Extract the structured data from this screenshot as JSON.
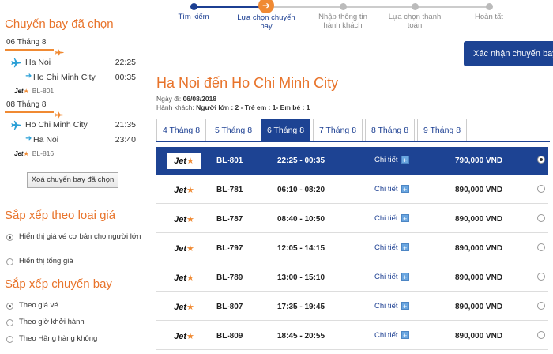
{
  "sidebar": {
    "selected_title": "Chuyến bay đã chọn",
    "segments": [
      {
        "date": "06 Tháng 8",
        "from": "Ha Noi",
        "dep_time": "22:25",
        "to": "Ho Chi Minh City",
        "arr_time": "00:35",
        "airline_logo": "Jet",
        "flight": "BL-801"
      },
      {
        "date": "08 Tháng 8",
        "from": "Ho Chi Minh City",
        "dep_time": "21:35",
        "to": "Ha Noi",
        "arr_time": "23:40",
        "airline_logo": "Jet",
        "flight": "BL-816"
      }
    ],
    "clear_button": "Xoá chuyến bay đã chọn",
    "price_sort_title": "Sắp xếp theo loại giá",
    "price_options": [
      "Hiển thị giá vé cơ bản cho người lớn",
      "Hiển thị tổng giá"
    ],
    "price_selected": 0,
    "flight_sort_title": "Sắp xếp chuyến bay",
    "flight_options": [
      "Theo giá vé",
      "Theo giờ khởi hành",
      "Theo Hãng hàng không"
    ],
    "flight_selected": 0
  },
  "stepper": {
    "steps": [
      "Tìm kiếm",
      "Lựa chọn chuyến bay",
      "Nhập thông tin hành khách",
      "Lựa chọn thanh toán",
      "Hoàn tất"
    ],
    "step_lines": [
      [
        "Tìm kiếm"
      ],
      [
        "Lựa chọn chuyến",
        "bay"
      ],
      [
        "Nhập thông tin",
        "hành khách"
      ],
      [
        "Lựa chọn thanh",
        "toán"
      ],
      [
        "Hoàn tất"
      ]
    ],
    "active_index": 1,
    "active_icon": "➔"
  },
  "confirm_button": "Xác nhận chuyến bay",
  "route": {
    "from": "Ha Noi",
    "connector": "đến",
    "to": "Ho Chi Minh City"
  },
  "departure_label": "Ngày đi:",
  "departure_date": "06/08/2018",
  "passenger_label": "Hành khách:",
  "passengers": "Người lớn : 2 - Trẻ em : 1- Em bé : 1",
  "date_tabs": [
    "4 Tháng 8",
    "5 Tháng 8",
    "6 Tháng 8",
    "7 Tháng 8",
    "8 Tháng 8",
    "9 Tháng 8"
  ],
  "active_tab": 2,
  "flights": [
    {
      "logo": "Jet",
      "code": "BL-801",
      "times": "22:25 - 00:35",
      "detail": "Chi tiết",
      "price": "790,000 VND",
      "selected": true
    },
    {
      "logo": "Jet",
      "code": "BL-781",
      "times": "06:10 - 08:20",
      "detail": "Chi tiết",
      "price": "890,000 VND",
      "selected": false
    },
    {
      "logo": "Jet",
      "code": "BL-787",
      "times": "08:40 - 10:50",
      "detail": "Chi tiết",
      "price": "890,000 VND",
      "selected": false
    },
    {
      "logo": "Jet",
      "code": "BL-797",
      "times": "12:05 - 14:15",
      "detail": "Chi tiết",
      "price": "890,000 VND",
      "selected": false
    },
    {
      "logo": "Jet",
      "code": "BL-789",
      "times": "13:00 - 15:10",
      "detail": "Chi tiết",
      "price": "890,000 VND",
      "selected": false
    },
    {
      "logo": "Jet",
      "code": "BL-807",
      "times": "17:35 - 19:45",
      "detail": "Chi tiết",
      "price": "890,000 VND",
      "selected": false
    },
    {
      "logo": "Jet",
      "code": "BL-809",
      "times": "18:45 - 20:55",
      "detail": "Chi tiết",
      "price": "890,000 VND",
      "selected": false
    }
  ],
  "colors": {
    "accent_orange": "#f08a33",
    "brand_blue": "#1d4393",
    "plane_blue": "#2a9fd6"
  }
}
